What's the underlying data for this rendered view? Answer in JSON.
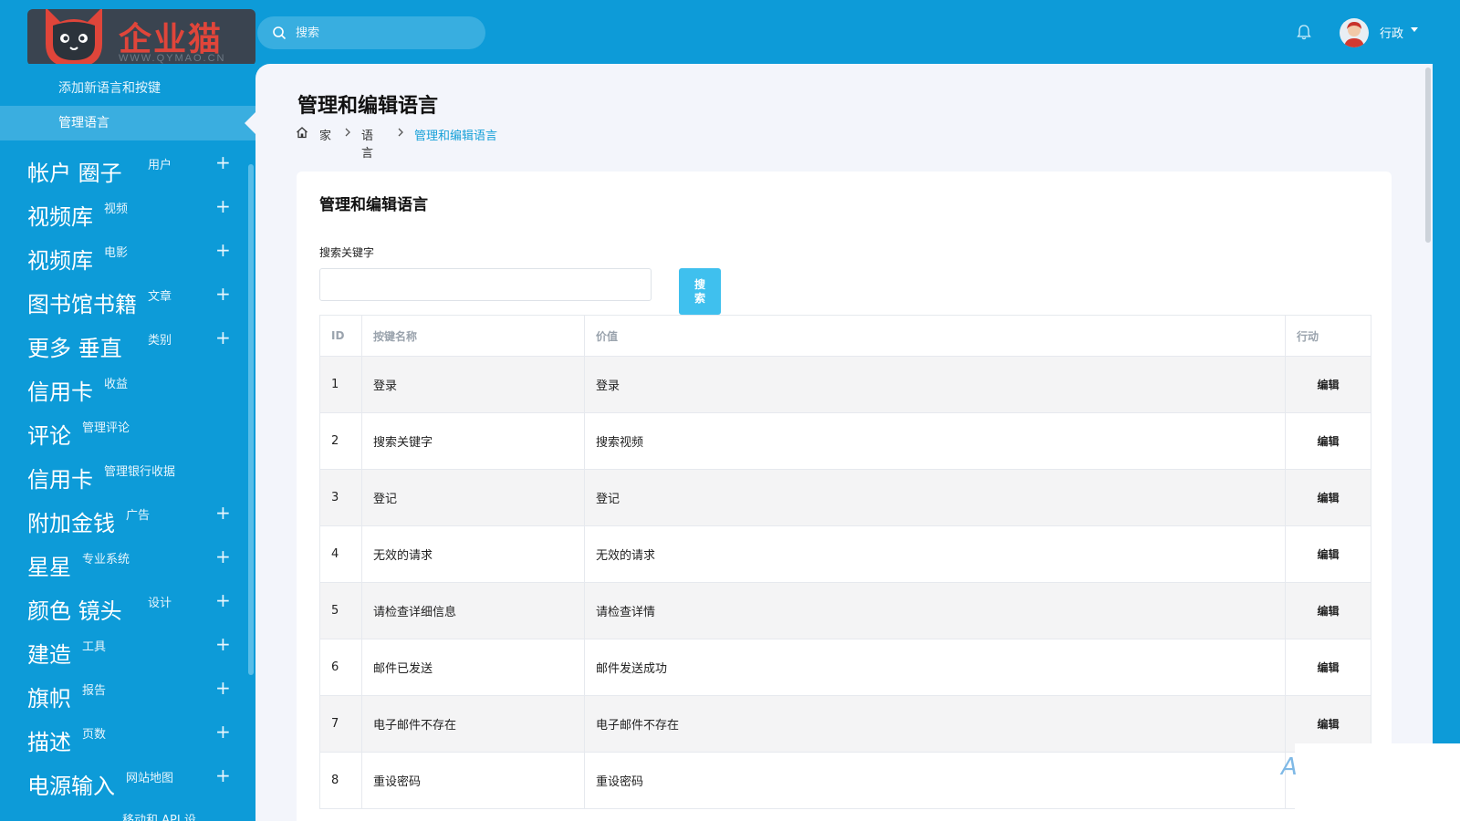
{
  "header": {
    "logo_text": "企业猫",
    "logo_sub": "WWW.QYMAO.CN",
    "search_placeholder": "搜索",
    "user_name": "行政"
  },
  "sidebar": {
    "sub_items": [
      {
        "label": "添加新语言和按键",
        "active": false
      },
      {
        "label": "管理语言",
        "active": true
      }
    ],
    "items": [
      {
        "main": "帐户  圈子",
        "sub": "用户",
        "plus": "+"
      },
      {
        "main": "视频库",
        "sub": "视频",
        "plus": "+"
      },
      {
        "main": "视频库",
        "sub": "电影",
        "plus": "+"
      },
      {
        "main": "图书馆书籍",
        "sub": "文章",
        "plus": "+"
      },
      {
        "main": "更多  垂直",
        "sub": "类别",
        "plus": "+"
      },
      {
        "main": "信用卡",
        "sub": "收益",
        "plus": ""
      },
      {
        "main": "评论",
        "sub": "管理评论",
        "plus": ""
      },
      {
        "main": "信用卡",
        "sub": "管理银行收据",
        "plus": ""
      },
      {
        "main": "附加金钱",
        "sub": "广告",
        "plus": "+"
      },
      {
        "main": "星星",
        "sub": "专业系统",
        "plus": "+"
      },
      {
        "main": "颜色  镜头",
        "sub": "设计",
        "plus": "+"
      },
      {
        "main": "建造",
        "sub": "工具",
        "plus": "+"
      },
      {
        "main": "旗帜",
        "sub": "报告",
        "plus": "+"
      },
      {
        "main": "描述",
        "sub": "页数",
        "plus": "+"
      },
      {
        "main": "电源输入",
        "sub": "网站地图",
        "plus": "+"
      }
    ],
    "bottom_text": "移动和 API 设"
  },
  "page": {
    "title": "管理和编辑语言",
    "breadcrumb": [
      "家",
      "语言",
      "管理和编辑语言"
    ]
  },
  "card": {
    "title": "管理和编辑语言",
    "keyword_label": "搜索关键字",
    "keyword_value": "",
    "search_button": "搜索",
    "columns": [
      "ID",
      "按键名称",
      "价值",
      "行动"
    ],
    "rows": [
      {
        "id": "1",
        "key": "登录",
        "value": "登录",
        "action": "编辑"
      },
      {
        "id": "2",
        "key": "搜索关键字",
        "value": "搜索视频",
        "action": "编辑"
      },
      {
        "id": "3",
        "key": "登记",
        "value": "登记",
        "action": "编辑"
      },
      {
        "id": "4",
        "key": "无效的请求",
        "value": "无效的请求",
        "action": "编辑"
      },
      {
        "id": "5",
        "key": "请检查详细信息",
        "value": "请检查详情",
        "action": "编辑"
      },
      {
        "id": "6",
        "key": "邮件已发送",
        "value": "邮件发送成功",
        "action": "编辑"
      },
      {
        "id": "7",
        "key": "电子邮件不存在",
        "value": "电子邮件不存在",
        "action": "编辑"
      },
      {
        "id": "8",
        "key": "重设密码",
        "value": "重设密码",
        "action": ""
      }
    ]
  },
  "colors": {
    "primary": "#0d9bd8",
    "sidebar_active": "#3aaee0",
    "link": "#16a0d8",
    "button": "#3fc0ee",
    "page_bg": "#f3f5fb"
  },
  "icons": {
    "search": "search-icon",
    "bell": "bell-icon",
    "home": "home-icon",
    "separator": "chevron-right-icon",
    "expand": "plus-icon"
  }
}
